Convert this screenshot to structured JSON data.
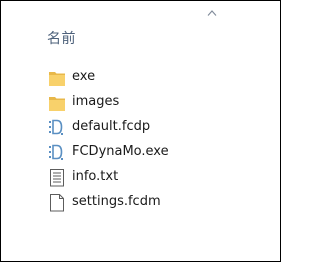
{
  "column_header": {
    "label": "名前",
    "sort_direction": "ascending"
  },
  "files": [
    {
      "name": "exe",
      "icon": "folder-icon"
    },
    {
      "name": "images",
      "icon": "folder-icon"
    },
    {
      "name": "default.fcdp",
      "icon": "fcdynamo-file-icon"
    },
    {
      "name": "FCDynaMo.exe",
      "icon": "fcdynamo-file-icon"
    },
    {
      "name": "info.txt",
      "icon": "text-file-icon"
    },
    {
      "name": "settings.fcdm",
      "icon": "blank-file-icon"
    }
  ],
  "colors": {
    "folder": "#f8d16b",
    "folder_tab": "#e8b84a",
    "fcd_icon": "#5a8fc2",
    "header_text": "#4c607a"
  }
}
